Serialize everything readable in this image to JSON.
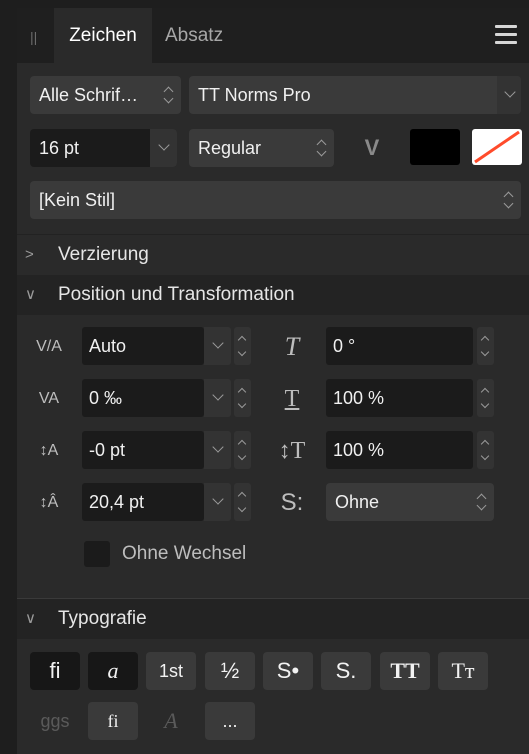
{
  "tabs": {
    "active": "Zeichen",
    "inactive": "Absatz"
  },
  "font": {
    "collection": "Alle Schrif…",
    "family": "TT Norms Pro",
    "size": "16 pt",
    "style": "Regular"
  },
  "style_select": "[Kein Stil]",
  "sections": {
    "ornament": "Verzierung",
    "position": "Position und Transformation",
    "typography": "Typografie"
  },
  "position": {
    "kerning": "Auto",
    "shear": "0 °",
    "tracking": "0 ‰",
    "horiz_scale": "100 %",
    "baseline": "-0 pt",
    "vert_scale": "100 %",
    "leading": "20,4 pt",
    "spacing_select": "Ohne"
  },
  "checkbox_label": "Ohne Wechsel",
  "typography_buttons": [
    "fi",
    "a",
    "1st",
    "½",
    "S•",
    "S.",
    "TT",
    "Tт"
  ],
  "typography_row2": [
    "ggs",
    "fi",
    "A",
    "..."
  ],
  "colors": {
    "fill": "#000000",
    "stroke_none": "#ff4b2b"
  }
}
